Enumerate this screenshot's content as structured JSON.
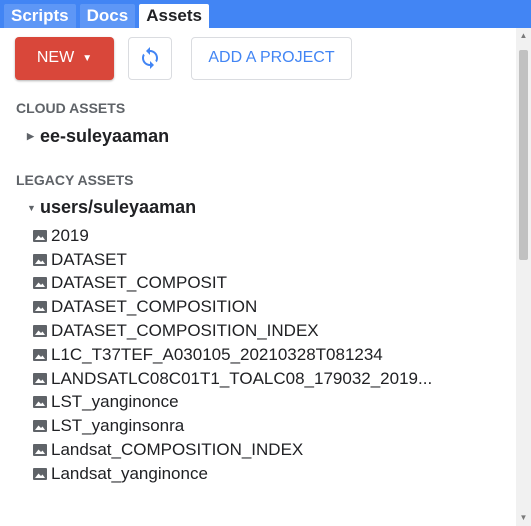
{
  "tabs": [
    {
      "label": "Scripts",
      "active": false
    },
    {
      "label": "Docs",
      "active": false
    },
    {
      "label": "Assets",
      "active": true
    }
  ],
  "toolbar": {
    "new_label": "NEW",
    "refresh_icon": "refresh-icon",
    "add_project_label": "ADD A PROJECT"
  },
  "cloud_assets": {
    "heading": "CLOUD ASSETS",
    "project": "ee-suleyaaman",
    "expanded": false
  },
  "legacy_assets": {
    "heading": "LEGACY ASSETS",
    "folder": "users/suleyaaman",
    "expanded": true,
    "items": [
      "2019",
      "DATASET",
      "DATASET_COMPOSIT",
      "DATASET_COMPOSITION",
      "DATASET_COMPOSITION_INDEX",
      "L1C_T37TEF_A030105_20210328T081234",
      "LANDSATLC08C01T1_TOALC08_179032_2019...",
      "LST_yanginonce",
      "LST_yanginsonra",
      "Landsat_COMPOSITION_INDEX",
      "Landsat_yanginonce"
    ]
  },
  "colors": {
    "tabbar": "#4285f4",
    "new_button": "#d9473a",
    "link_blue": "#4285f4"
  }
}
